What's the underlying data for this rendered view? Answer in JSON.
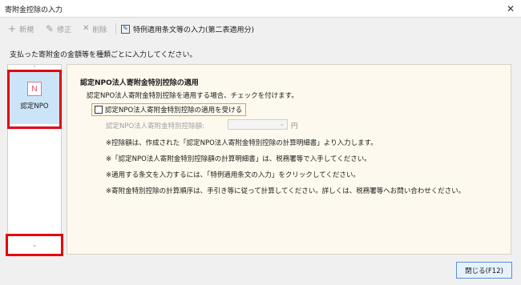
{
  "window": {
    "title": "寄附金控除の入力",
    "close_glyph": "✕"
  },
  "toolbar": {
    "new": {
      "icon": "plus-icon",
      "glyph": "+",
      "label": "新規"
    },
    "edit": {
      "icon": "pencil-icon",
      "glyph": "✎",
      "label": "修正"
    },
    "delete": {
      "icon": "x-icon",
      "glyph": "✕",
      "label": "削除"
    },
    "special": {
      "icon": "edit-box-icon",
      "glyph": "✎",
      "label": "特例適用条文等の入力(第二表適用分)"
    }
  },
  "instruction": "支払った寄附金の金額等を種類ごとに入力してください。",
  "sidebar": {
    "scroll_up_glyph": "⌃",
    "scroll_down_glyph": "⌄",
    "items": [
      {
        "icon_letter": "N",
        "label": "認定NPO",
        "selected": true
      }
    ]
  },
  "main": {
    "section_title": "認定NPO法人寄附金特別控除の適用",
    "description": "認定NPO法人寄附金特別控除を適用する場合、チェックを付けます。",
    "checkbox": {
      "label": "認定NPO法人寄附金特別控除の適用を受ける",
      "checked": false
    },
    "amount": {
      "label": "認定NPO法人寄附金特別控除額:",
      "value": "",
      "unit": "円"
    },
    "notes": [
      "※控除額は、作成された「認定NPO法人寄附金特別控除の計算明細書」より入力します。",
      "※「認定NPO法人寄附金特別控除額の計算明細書」は、税務署等で入手してください。",
      "※適用する条文を入力するには、「特例適用条文の入力」をクリックしてください。",
      "※寄附金特別控除の計算順序は、手引き等に従って計算してください。詳しくは、税務署等へお問い合わせください。"
    ]
  },
  "footer": {
    "close_label": "閉じる(F12)"
  },
  "colors": {
    "highlight": "#e60012",
    "selected_bg": "#cce4f7",
    "panel_bg": "#fdf9ee"
  }
}
